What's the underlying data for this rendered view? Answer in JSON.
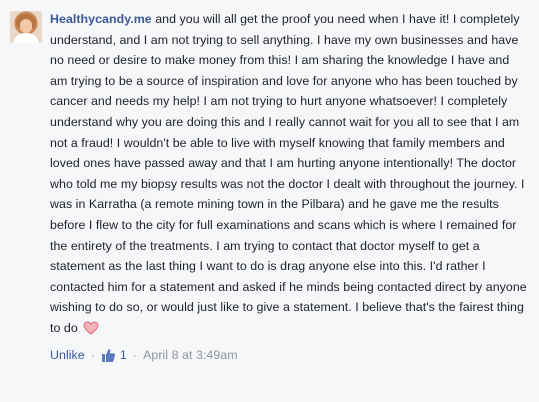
{
  "comment": {
    "author": "Healthycandy.me",
    "text": " and you will all get the proof you need when I have it! I completely understand, and I am not trying to sell anything. I have my own businesses and have no need or desire to make money from this! I am sharing the knowledge I have and am trying to be a source of inspiration and love for anyone who has been touched by cancer and needs my help! I am not trying to hurt anyone whatsoever! I completely understand why you are doing this and I really cannot wait for you all to see that I am not a fraud! I wouldn't be able to live with myself knowing that family members and loved ones have passed away and that I am hurting anyone intentionally! The doctor who told me my biopsy results was not the doctor I dealt with throughout the journey. I was in Karratha (a remote mining town in the Pilbara) and he gave me the results before I flew to the city for full examinations and scans which is where I remained for the entirety of the treatments. I am trying to contact that doctor myself to get a statement as the last thing I want to do is drag anyone else into this. I'd rather I contacted him for a statement and asked if he minds being contacted direct by anyone wishing to do so, or would just like to give a statement. I believe that's the fairest thing to do",
    "emoji_icon": "heart-icon"
  },
  "actions": {
    "unlike_label": "Unlike",
    "separator": "·",
    "like_icon": "thumbs-up-icon",
    "like_count": "1",
    "timestamp": "April 8 at 3:49am"
  },
  "colors": {
    "link": "#3b5998",
    "text": "#1d2129",
    "meta": "#90949c",
    "heart": "#e9868f",
    "background": "#f6f7f9"
  }
}
